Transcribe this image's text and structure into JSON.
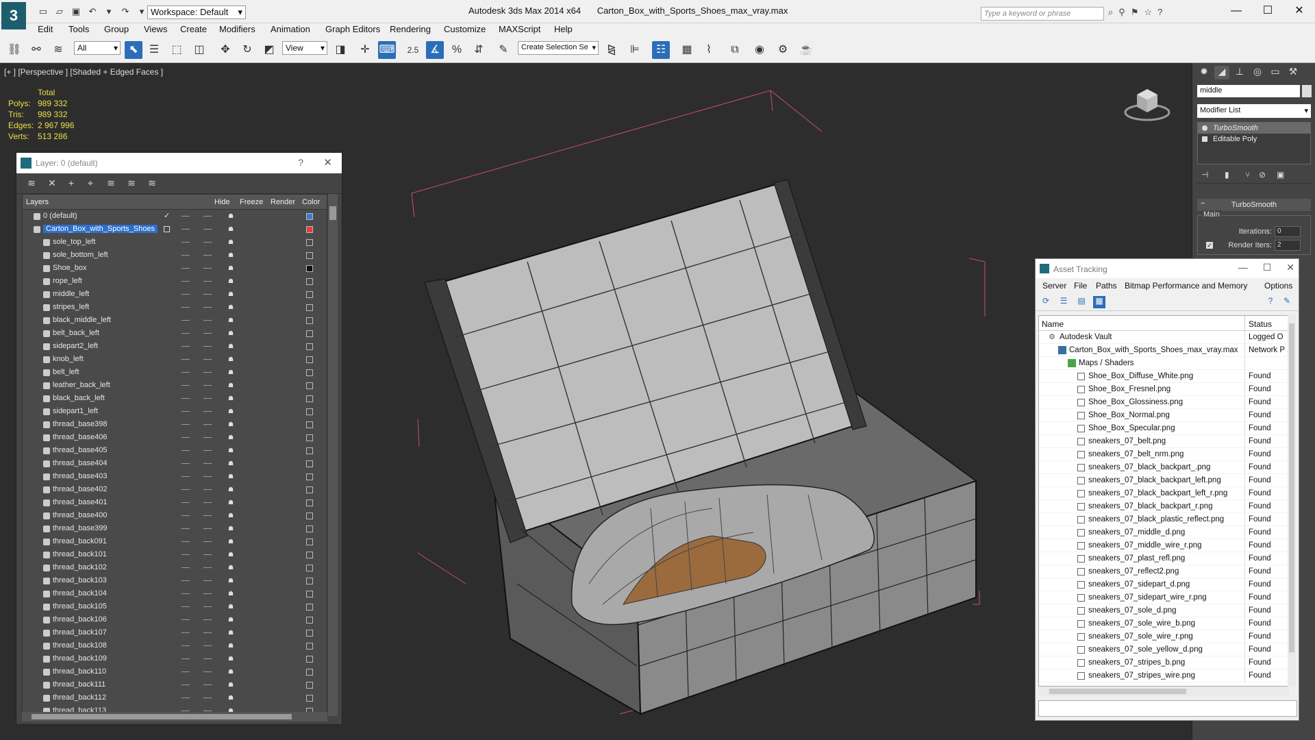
{
  "title": {
    "app": "Autodesk 3ds Max  2014 x64",
    "file": "Carton_Box_with_Sports_Shoes_max_vray.max",
    "workspace": "Workspace: Default",
    "search_placeholder": "Type a keyword or phrase"
  },
  "menu": [
    "Edit",
    "Tools",
    "Group",
    "Views",
    "Create",
    "Modifiers",
    "Animation",
    "Graph Editors",
    "Rendering",
    "Customize",
    "MAXScript",
    "Help"
  ],
  "toolbar": {
    "filter": "All",
    "ref_coord": "View",
    "selection_set": "Create Selection Se",
    "snap_label": "2.5"
  },
  "viewport": {
    "label": "[+ ] [Perspective ] [Shaded + Edged Faces ]",
    "stats_header": "Total",
    "stats": [
      {
        "k": "Polys:",
        "v": "989 332"
      },
      {
        "k": "Tris:",
        "v": "989 332"
      },
      {
        "k": "Edges:",
        "v": "2 967 996"
      },
      {
        "k": "Verts:",
        "v": "513 286"
      }
    ]
  },
  "layer_window": {
    "title": "Layer: 0 (default)",
    "help": "?",
    "close": "✕",
    "columns": {
      "layers": "Layers",
      "hide": "Hide",
      "freeze": "Freeze",
      "render": "Render",
      "color": "Color"
    },
    "rows": [
      {
        "name": "0 (default)",
        "level": 0,
        "color": "#3a7bd5",
        "check": true
      },
      {
        "name": "Carton_Box_with_Sports_Shoes",
        "level": 0,
        "color": "#e0423c",
        "selected": true
      },
      {
        "name": "sole_top_left",
        "level": 1,
        "color": "#4a4a4a"
      },
      {
        "name": "sole_bottom_left",
        "level": 1,
        "color": "#4a4a4a"
      },
      {
        "name": "Shoe_box",
        "level": 1,
        "color": "#111111"
      },
      {
        "name": "rope_left",
        "level": 1,
        "color": "#4a4a4a"
      },
      {
        "name": "middle_left",
        "level": 1,
        "color": "#4a4a4a"
      },
      {
        "name": "stripes_left",
        "level": 1,
        "color": "#4a4a4a"
      },
      {
        "name": "black_middle_left",
        "level": 1,
        "color": "#4a4a4a"
      },
      {
        "name": "belt_back_left",
        "level": 1,
        "color": "#4a4a4a"
      },
      {
        "name": "sidepart2_left",
        "level": 1,
        "color": "#4a4a4a"
      },
      {
        "name": "knob_left",
        "level": 1,
        "color": "#4a4a4a"
      },
      {
        "name": "belt_left",
        "level": 1,
        "color": "#4a4a4a"
      },
      {
        "name": "leather_back_left",
        "level": 1,
        "color": "#4a4a4a"
      },
      {
        "name": "black_back_left",
        "level": 1,
        "color": "#4a4a4a"
      },
      {
        "name": "sidepart1_left",
        "level": 1,
        "color": "#4a4a4a"
      },
      {
        "name": "thread_base398",
        "level": 1,
        "color": "#4a4a4a"
      },
      {
        "name": "thread_base406",
        "level": 1,
        "color": "#4a4a4a"
      },
      {
        "name": "thread_base405",
        "level": 1,
        "color": "#4a4a4a"
      },
      {
        "name": "thread_base404",
        "level": 1,
        "color": "#4a4a4a"
      },
      {
        "name": "thread_base403",
        "level": 1,
        "color": "#4a4a4a"
      },
      {
        "name": "thread_base402",
        "level": 1,
        "color": "#4a4a4a"
      },
      {
        "name": "thread_base401",
        "level": 1,
        "color": "#4a4a4a"
      },
      {
        "name": "thread_base400",
        "level": 1,
        "color": "#4a4a4a"
      },
      {
        "name": "thread_base399",
        "level": 1,
        "color": "#4a4a4a"
      },
      {
        "name": "thread_back091",
        "level": 1,
        "color": "#4a4a4a"
      },
      {
        "name": "thread_back101",
        "level": 1,
        "color": "#4a4a4a"
      },
      {
        "name": "thread_back102",
        "level": 1,
        "color": "#4a4a4a"
      },
      {
        "name": "thread_back103",
        "level": 1,
        "color": "#4a4a4a"
      },
      {
        "name": "thread_back104",
        "level": 1,
        "color": "#4a4a4a"
      },
      {
        "name": "thread_back105",
        "level": 1,
        "color": "#4a4a4a"
      },
      {
        "name": "thread_back106",
        "level": 1,
        "color": "#4a4a4a"
      },
      {
        "name": "thread_back107",
        "level": 1,
        "color": "#4a4a4a"
      },
      {
        "name": "thread_back108",
        "level": 1,
        "color": "#4a4a4a"
      },
      {
        "name": "thread_back109",
        "level": 1,
        "color": "#4a4a4a"
      },
      {
        "name": "thread_back110",
        "level": 1,
        "color": "#4a4a4a"
      },
      {
        "name": "thread_back111",
        "level": 1,
        "color": "#4a4a4a"
      },
      {
        "name": "thread_back112",
        "level": 1,
        "color": "#4a4a4a"
      },
      {
        "name": "thread_back113",
        "level": 1,
        "color": "#4a4a4a"
      }
    ]
  },
  "command_panel": {
    "object_name": "middle",
    "modifier_list": "Modifier List",
    "stack": [
      {
        "label": "TurboSmooth",
        "active": true
      },
      {
        "label": "Editable Poly",
        "active": false
      }
    ],
    "rollout_title": "TurboSmooth",
    "group_main": "Main",
    "iterations_label": "Iterations:",
    "iterations_value": "0",
    "render_iters_label": "Render Iters:",
    "render_iters_value": "2"
  },
  "asset_tracking": {
    "title": "Asset Tracking",
    "menu": [
      "Server",
      "File",
      "Paths",
      "Bitmap Performance and Memory",
      "Options"
    ],
    "col_name": "Name",
    "col_status": "Status",
    "rows": [
      {
        "name": "Autodesk Vault",
        "status": "Logged O",
        "level": 0,
        "kind": "vault"
      },
      {
        "name": "Carton_Box_with_Sports_Shoes_max_vray.max",
        "status": "Network P",
        "level": 1,
        "kind": "max"
      },
      {
        "name": "Maps / Shaders",
        "status": "",
        "level": 2,
        "kind": "folder"
      },
      {
        "name": "Shoe_Box_Diffuse_White.png",
        "status": "Found",
        "level": 3,
        "kind": "file"
      },
      {
        "name": "Shoe_Box_Fresnel.png",
        "status": "Found",
        "level": 3,
        "kind": "file"
      },
      {
        "name": "Shoe_Box_Glossiness.png",
        "status": "Found",
        "level": 3,
        "kind": "file"
      },
      {
        "name": "Shoe_Box_Normal.png",
        "status": "Found",
        "level": 3,
        "kind": "file"
      },
      {
        "name": "Shoe_Box_Specular.png",
        "status": "Found",
        "level": 3,
        "kind": "file"
      },
      {
        "name": "sneakers_07_belt.png",
        "status": "Found",
        "level": 3,
        "kind": "file"
      },
      {
        "name": "sneakers_07_belt_nrm.png",
        "status": "Found",
        "level": 3,
        "kind": "file"
      },
      {
        "name": "sneakers_07_black_backpart_.png",
        "status": "Found",
        "level": 3,
        "kind": "file"
      },
      {
        "name": "sneakers_07_black_backpart_left.png",
        "status": "Found",
        "level": 3,
        "kind": "file"
      },
      {
        "name": "sneakers_07_black_backpart_left_r.png",
        "status": "Found",
        "level": 3,
        "kind": "file"
      },
      {
        "name": "sneakers_07_black_backpart_r.png",
        "status": "Found",
        "level": 3,
        "kind": "file"
      },
      {
        "name": "sneakers_07_black_plastic_reflect.png",
        "status": "Found",
        "level": 3,
        "kind": "file"
      },
      {
        "name": "sneakers_07_middle_d.png",
        "status": "Found",
        "level": 3,
        "kind": "file"
      },
      {
        "name": "sneakers_07_middle_wire_r.png",
        "status": "Found",
        "level": 3,
        "kind": "file"
      },
      {
        "name": "sneakers_07_plast_refl.png",
        "status": "Found",
        "level": 3,
        "kind": "file"
      },
      {
        "name": "sneakers_07_reflect2.png",
        "status": "Found",
        "level": 3,
        "kind": "file"
      },
      {
        "name": "sneakers_07_sidepart_d.png",
        "status": "Found",
        "level": 3,
        "kind": "file"
      },
      {
        "name": "sneakers_07_sidepart_wire_r.png",
        "status": "Found",
        "level": 3,
        "kind": "file"
      },
      {
        "name": "sneakers_07_sole_d.png",
        "status": "Found",
        "level": 3,
        "kind": "file"
      },
      {
        "name": "sneakers_07_sole_wire_b.png",
        "status": "Found",
        "level": 3,
        "kind": "file"
      },
      {
        "name": "sneakers_07_sole_wire_r.png",
        "status": "Found",
        "level": 3,
        "kind": "file"
      },
      {
        "name": "sneakers_07_sole_yellow_d.png",
        "status": "Found",
        "level": 3,
        "kind": "file"
      },
      {
        "name": "sneakers_07_stripes_b.png",
        "status": "Found",
        "level": 3,
        "kind": "file"
      },
      {
        "name": "sneakers_07_stripes_wire.png",
        "status": "Found",
        "level": 3,
        "kind": "file"
      }
    ]
  }
}
